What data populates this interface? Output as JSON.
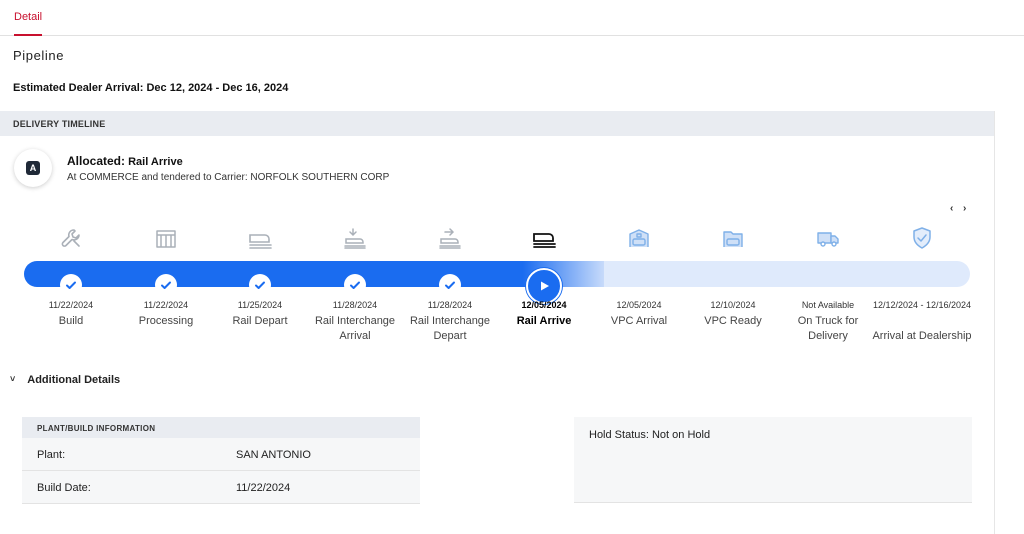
{
  "tabs": [
    {
      "label": "Detail",
      "active": true
    }
  ],
  "pipeline_title": "Pipeline",
  "eta": "Estimated Dealer Arrival: Dec 12, 2024 - Dec 16, 2024",
  "timeline": {
    "header": "DELIVERY TIMELINE",
    "status": {
      "icon": "logo-icon",
      "icon_letter": "A",
      "label": "Allocated:",
      "value": "Rail Arrive",
      "detail": "At COMMERCE and tendered to Carrier: NORFOLK SOUTHERN CORP"
    },
    "nav_prev": "‹",
    "nav_next": "›",
    "accent_color": "#1a6cf0",
    "steps": [
      {
        "date": "11/22/2024",
        "label": "Build",
        "state": "done",
        "icon": "wrench-icon"
      },
      {
        "date": "11/22/2024",
        "label": "Processing",
        "state": "done",
        "icon": "factory-icon"
      },
      {
        "date": "11/25/2024",
        "label": "Rail Depart",
        "state": "done",
        "icon": "train-icon"
      },
      {
        "date": "11/28/2024",
        "label": "Rail Interchange Arrival",
        "state": "done",
        "icon": "rail-interchange-arrival-icon"
      },
      {
        "date": "11/28/2024",
        "label": "Rail Interchange Depart",
        "state": "done",
        "icon": "rail-interchange-depart-icon"
      },
      {
        "date": "12/05/2024",
        "label": "Rail Arrive",
        "state": "current",
        "icon": "train-arrive-icon"
      },
      {
        "date": "12/05/2024",
        "label": "VPC Arrival",
        "state": "future",
        "icon": "vpc-arrival-icon"
      },
      {
        "date": "12/10/2024",
        "label": "VPC Ready",
        "state": "future",
        "icon": "vpc-ready-icon"
      },
      {
        "date": "Not Available",
        "label": "On Truck for Delivery",
        "state": "future",
        "icon": "truck-icon"
      },
      {
        "date": "12/12/2024 - 12/16/2024",
        "label": "Arrival at Dealership",
        "state": "future",
        "icon": "shield-check-icon"
      }
    ]
  },
  "additional_details": {
    "label": "Additional Details",
    "plant": {
      "header": "PLANT/BUILD INFORMATION",
      "rows": [
        {
          "key": "Plant:",
          "value": "SAN ANTONIO"
        },
        {
          "key": "Build Date:",
          "value": "11/22/2024"
        }
      ]
    },
    "hold_status": "Hold Status: Not on Hold"
  }
}
